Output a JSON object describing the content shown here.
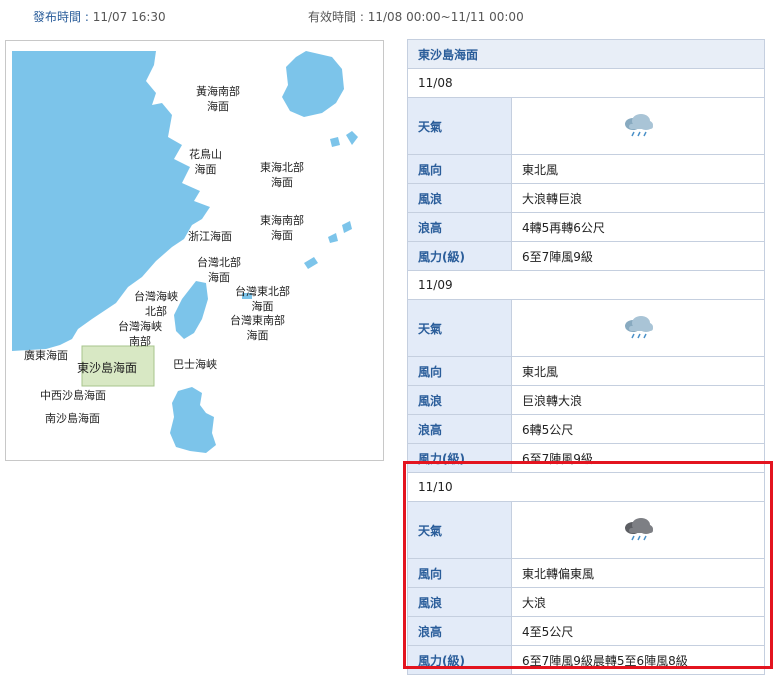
{
  "header": {
    "publish_label": "發布時間 :",
    "publish_time": "11/07 16:30",
    "valid_label": "有效時間 :",
    "valid_time": "11/08 00:00~11/11 00:00"
  },
  "map": {
    "labels": {
      "huanghai_s": "黃海南部\n海面",
      "huaniaoshan": "花鳥山\n海面",
      "donghai_n": "東海北部\n海面",
      "donghai_s": "東海南部\n海面",
      "zhejiang": "浙江海面",
      "taiwan_n": "台灣北部\n海面",
      "strait_n": "台灣海峽\n北部",
      "taiwan_ne": "台灣東北部\n海面",
      "strait_s": "台灣海峽\n南部",
      "taiwan_se": "台灣東南部\n海面",
      "guangdong": "廣東海面",
      "dongsha": "東沙島海面",
      "bashi": "巴士海峽",
      "zhongxisha": "中西沙島海面",
      "nansha": "南沙島海面"
    }
  },
  "forecast": {
    "area_title": "東沙島海面",
    "days": [
      {
        "date": "11/08",
        "weather_label": "天氣",
        "weather_icon": "rain-cloud-icon",
        "rows": [
          {
            "key": "風向",
            "value": "東北風"
          },
          {
            "key": "風浪",
            "value": "大浪轉巨浪"
          },
          {
            "key": "浪高",
            "value": "4轉5再轉6公尺"
          },
          {
            "key": "風力(級)",
            "value": "6至7陣風9級"
          }
        ]
      },
      {
        "date": "11/09",
        "weather_label": "天氣",
        "weather_icon": "rain-cloud-icon",
        "rows": [
          {
            "key": "風向",
            "value": "東北風"
          },
          {
            "key": "風浪",
            "value": "巨浪轉大浪"
          },
          {
            "key": "浪高",
            "value": "6轉5公尺"
          },
          {
            "key": "風力(級)",
            "value": "6至7陣風9級"
          }
        ]
      },
      {
        "date": "11/10",
        "weather_label": "天氣",
        "weather_icon": "dark-rain-cloud-icon",
        "rows": [
          {
            "key": "風向",
            "value": "東北轉偏東風"
          },
          {
            "key": "風浪",
            "value": "大浪"
          },
          {
            "key": "浪高",
            "value": "4至5公尺"
          },
          {
            "key": "風力(級)",
            "value": "6至7陣風9級晨轉5至6陣風8級"
          }
        ]
      }
    ]
  },
  "colors": {
    "sea_blue": "#7cc4ea",
    "dongsha_zone": "#d8e8c4",
    "highlight": "#e3141f",
    "label_blue": "#2a5d9a"
  }
}
